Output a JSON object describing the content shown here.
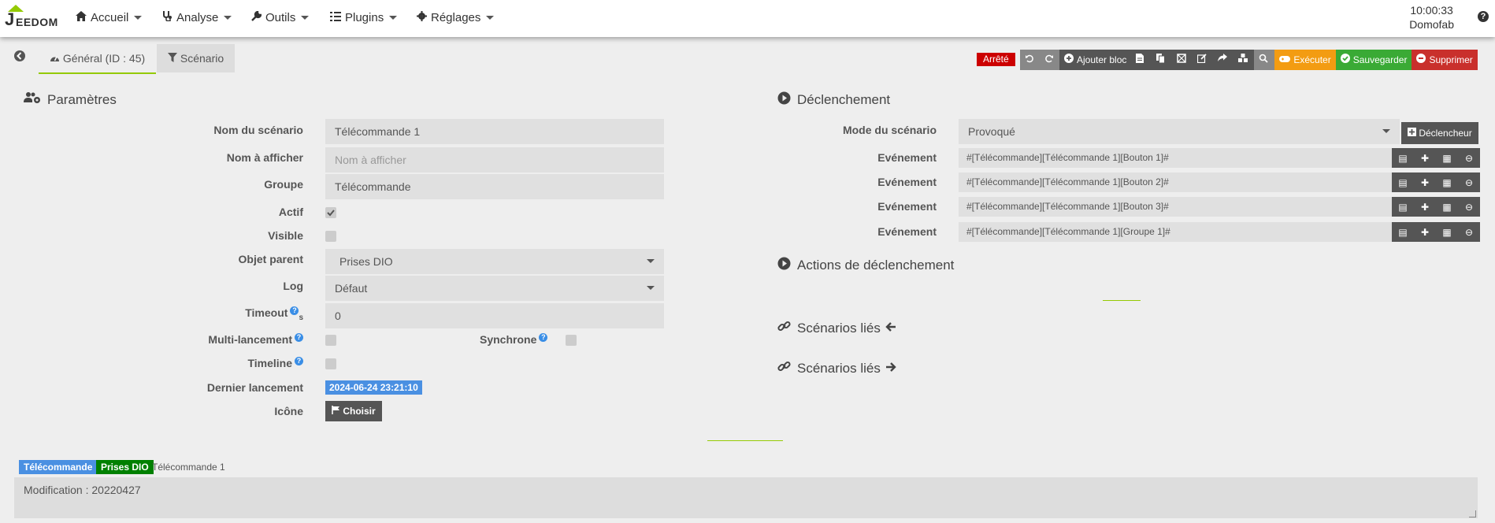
{
  "brand": {
    "logo_text": "EEDOM"
  },
  "nav": [
    {
      "label": "Accueil",
      "icon": "home-icon"
    },
    {
      "label": "Analyse",
      "icon": "stethoscope-icon"
    },
    {
      "label": "Outils",
      "icon": "wrench-icon"
    },
    {
      "label": "Plugins",
      "icon": "tasks-icon"
    },
    {
      "label": "Réglages",
      "icon": "gear-icon"
    }
  ],
  "clock": {
    "time": "10:00:33",
    "name": "Domofab"
  },
  "tabs": {
    "general": "Général (ID : 45)",
    "scenario": "Scénario"
  },
  "toolbar": {
    "status": "Arrêté",
    "add_block": "Ajouter bloc",
    "execute": "Exécuter",
    "save": "Sauvegarder",
    "delete": "Supprimer"
  },
  "params": {
    "title": "Paramètres",
    "name_label": "Nom du scénario",
    "name_value": "Télécommande 1",
    "display_label": "Nom à afficher",
    "display_placeholder": "Nom à afficher",
    "group_label": "Groupe",
    "group_value": "Télécommande",
    "active_label": "Actif",
    "visible_label": "Visible",
    "parent_label": "Objet parent",
    "parent_value": "Prises DIO",
    "log_label": "Log",
    "log_value": "Défaut",
    "timeout_label": "Timeout",
    "timeout_unit": "s",
    "timeout_value": "0",
    "multi_label": "Multi-lancement",
    "sync_label": "Synchrone",
    "timeline_label": "Timeline",
    "last_run_label": "Dernier lancement",
    "last_run_value": "2024-06-24 23:21:10",
    "icon_label": "Icône",
    "choose_label": "Choisir"
  },
  "trigger": {
    "title": "Déclenchement",
    "mode_label": "Mode du scénario",
    "mode_value": "Provoqué",
    "trigger_button": "Déclencheur",
    "events": [
      {
        "label": "Evénement",
        "value": "#[Télécommande][Télécommande 1][Bouton 1]#"
      },
      {
        "label": "Evénement",
        "value": "#[Télécommande][Télécommande 1][Bouton 2]#"
      },
      {
        "label": "Evénement",
        "value": "#[Télécommande][Télécommande 1][Bouton 3]#"
      },
      {
        "label": "Evénement",
        "value": "#[Télécommande][Télécommande 1][Groupe 1]#"
      }
    ],
    "actions_title": "Actions de déclenchement",
    "linked_in": "Scénarios liés",
    "linked_out": "Scénarios liés"
  },
  "footer": {
    "tag1": "Télécommande",
    "tag2": "Prises DIO",
    "tag3": "Télécommande 1",
    "comment": "Modification : 20220427"
  },
  "colors": {
    "accent": "#94ca02",
    "blue": "#4a90e2",
    "green_tag": "#008000",
    "red": "#c9302c",
    "orange": "#f39c12"
  }
}
